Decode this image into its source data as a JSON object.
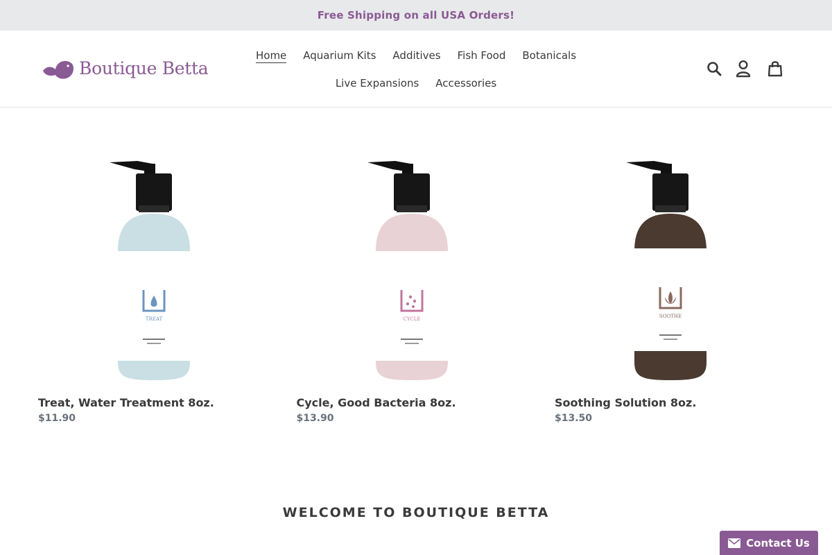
{
  "announcement": {
    "text": "Free Shipping on all USA Orders!"
  },
  "brand": {
    "name": "Boutique Betta",
    "color": "#8a5a94"
  },
  "nav": {
    "items": [
      {
        "label": "Home",
        "active": true
      },
      {
        "label": "Aquarium Kits"
      },
      {
        "label": "Additives"
      },
      {
        "label": "Fish Food"
      },
      {
        "label": "Botanicals"
      },
      {
        "label": "Live Expansions"
      },
      {
        "label": "Accessories"
      }
    ]
  },
  "header_icons": [
    "search-icon",
    "account-icon",
    "cart-icon"
  ],
  "products": [
    {
      "title": "Treat, Water Treatment 8oz.",
      "price": "$11.90",
      "bottle_color": "#c9dfe3",
      "label_color": "#6b94bf",
      "label_word": "TREAT"
    },
    {
      "title": "Cycle, Good Bacteria 8oz.",
      "price": "$13.90",
      "bottle_color": "#e8d2d6",
      "label_color": "#c0769c",
      "label_word": "CYCLE"
    },
    {
      "title": "Soothing Solution 8oz.",
      "price": "$13.50",
      "bottle_color": "#4a3a30",
      "label_color": "#8a6a5e",
      "label_word": "SOOTHE"
    }
  ],
  "welcome": {
    "heading": "WELCOME TO BOUTIQUE BETTA"
  },
  "contact": {
    "label": "Contact Us",
    "icon": "envelope-icon"
  }
}
